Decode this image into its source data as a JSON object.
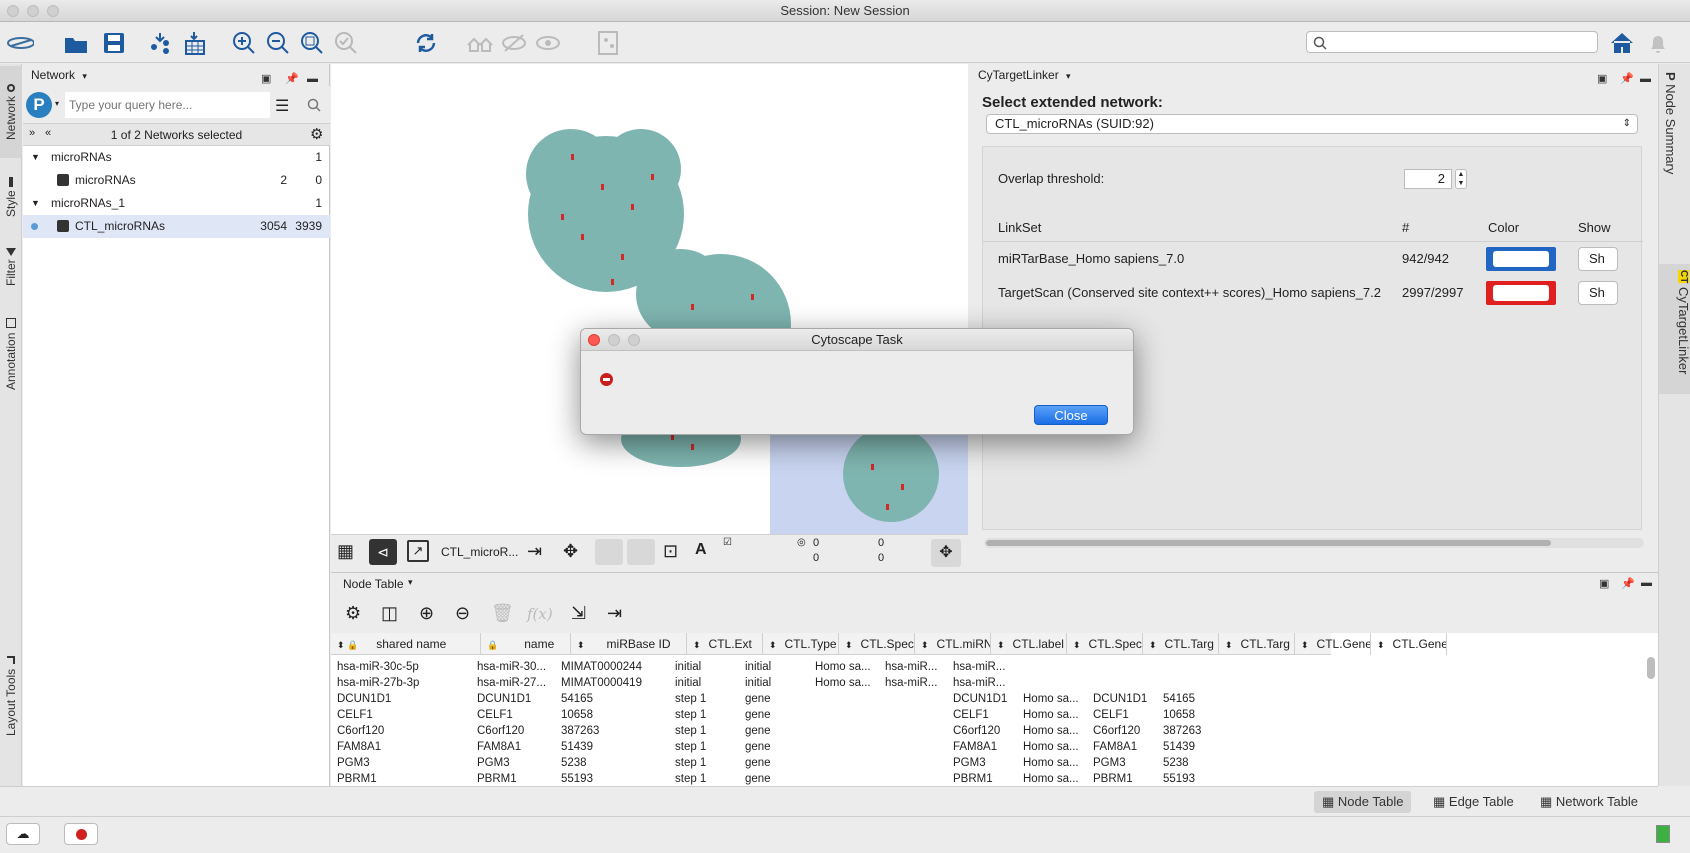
{
  "window": {
    "title": "Session: New Session"
  },
  "toolbar": {
    "search_placeholder": ""
  },
  "left_tabs": [
    "Network",
    "Style",
    "Filter",
    "Annotation",
    "Layout Tools"
  ],
  "network_panel": {
    "title": "Network",
    "query_placeholder": "Type your query here...",
    "selection_status": "1 of 2 Networks selected",
    "tree": [
      {
        "label": "microRNAs",
        "count": "1",
        "type": "collection"
      },
      {
        "label": "microRNAs",
        "nodes": "2",
        "edges": "0",
        "type": "network"
      },
      {
        "label": "microRNAs_1",
        "count": "1",
        "type": "collection"
      },
      {
        "label": "CTL_microRNAs",
        "nodes": "3054",
        "edges": "3939",
        "type": "network",
        "selected": true
      }
    ]
  },
  "view_toolbar": {
    "network_name": "CTL_microR...",
    "counts": {
      "selected_nodes": "0",
      "total_nodes": "0",
      "hidden_nodes": "0",
      "hidden_edges": "0"
    }
  },
  "right_panel": {
    "title": "CyTargetLinker",
    "select_label": "Select extended network:",
    "selected_network": "CTL_microRNAs (SUID:92)",
    "overlap_label": "Overlap threshold:",
    "overlap_value": "2",
    "headers": {
      "linkset": "LinkSet",
      "count": "#",
      "color": "Color",
      "show": "Show"
    },
    "linksets": [
      {
        "name": "miRTarBase_Homo sapiens_7.0",
        "count": "942/942",
        "color": "#2166c3",
        "show": "Sh"
      },
      {
        "name": "TargetScan (Conserved site context++ scores)_Homo sapiens_7.2",
        "count": "2997/2997",
        "color": "#e02020",
        "show": "Sh"
      }
    ]
  },
  "right_tabs": [
    "Node Summary",
    "CyTargetLinker"
  ],
  "table_panel": {
    "title": "Node Table",
    "columns": [
      "shared name",
      "name",
      "miRBase ID",
      "CTL.Ext",
      "CTL.Type",
      "CTL.Spec",
      "CTL.miRN",
      "CTL.label",
      "CTL.Spec",
      "CTL.Targ",
      "CTL.Targ",
      "CTL.Gene",
      "CTL.Gene"
    ],
    "rows": [
      [
        "hsa-miR-30c-5p",
        "hsa-miR-30...",
        "MIMAT0000244",
        "initial",
        "initial",
        "Homo sa...",
        "hsa-miR...",
        "hsa-miR...",
        "",
        "",
        "",
        "",
        ""
      ],
      [
        "hsa-miR-27b-3p",
        "hsa-miR-27...",
        "MIMAT0000419",
        "initial",
        "initial",
        "Homo sa...",
        "hsa-miR...",
        "hsa-miR...",
        "",
        "",
        "",
        "",
        ""
      ],
      [
        "DCUN1D1",
        "DCUN1D1",
        "54165",
        "step 1",
        "gene",
        "",
        "",
        "DCUN1D1",
        "Homo sa...",
        "DCUN1D1",
        "54165",
        "",
        ""
      ],
      [
        "CELF1",
        "CELF1",
        "10658",
        "step 1",
        "gene",
        "",
        "",
        "CELF1",
        "Homo sa...",
        "CELF1",
        "10658",
        "",
        ""
      ],
      [
        "C6orf120",
        "C6orf120",
        "387263",
        "step 1",
        "gene",
        "",
        "",
        "C6orf120",
        "Homo sa...",
        "C6orf120",
        "387263",
        "",
        ""
      ],
      [
        "FAM8A1",
        "FAM8A1",
        "51439",
        "step 1",
        "gene",
        "",
        "",
        "FAM8A1",
        "Homo sa...",
        "FAM8A1",
        "51439",
        "",
        ""
      ],
      [
        "PGM3",
        "PGM3",
        "5238",
        "step 1",
        "gene",
        "",
        "",
        "PGM3",
        "Homo sa...",
        "PGM3",
        "5238",
        "",
        ""
      ],
      [
        "PBRM1",
        "PBRM1",
        "55193",
        "step 1",
        "gene",
        "",
        "",
        "PBRM1",
        "Homo sa...",
        "PBRM1",
        "55193",
        "",
        ""
      ]
    ]
  },
  "bottom_tabs": [
    "Node Table",
    "Edge Table",
    "Network Table"
  ],
  "dialog": {
    "title": "Cytoscape Task",
    "close_label": "Close"
  }
}
